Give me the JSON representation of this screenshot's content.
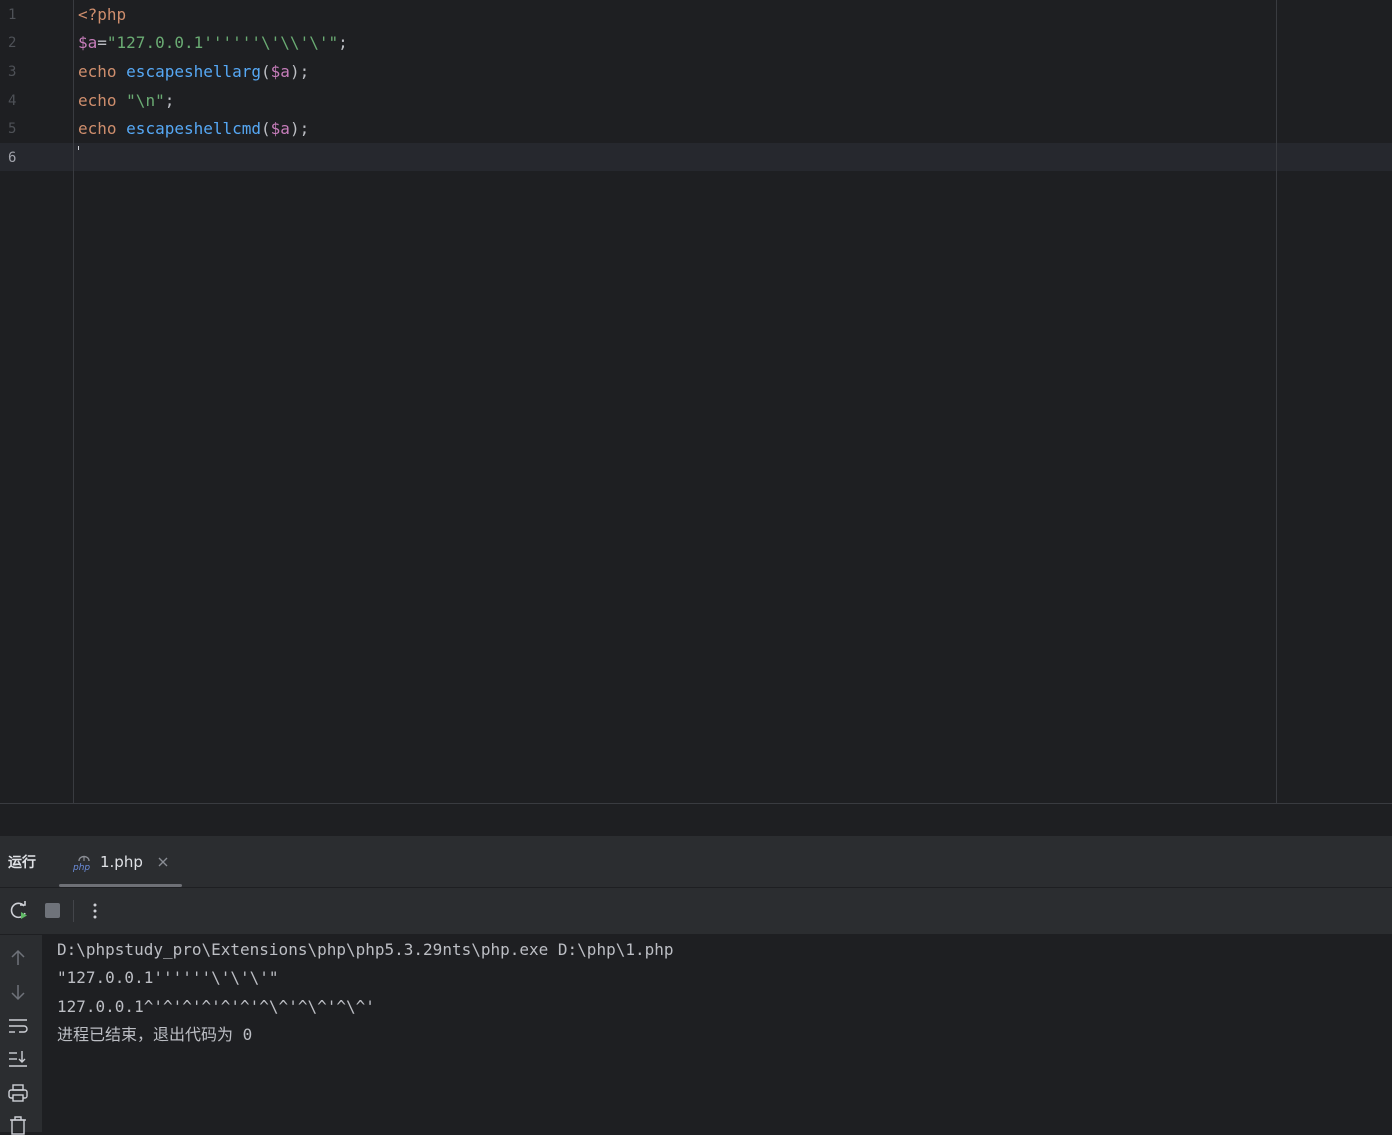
{
  "editor": {
    "line_numbers": [
      "1",
      "2",
      "3",
      "4",
      "5",
      "6"
    ],
    "lines": [
      [
        {
          "t": "<?php",
          "c": "#cf8e6d"
        }
      ],
      [
        {
          "t": "$a",
          "c": "#c77dbb"
        },
        {
          "t": "=",
          "c": "#bcbec4"
        },
        {
          "t": "\"127.0.0.1''''''\\'\\\\'\\'\"",
          "c": "#6aab73"
        },
        {
          "t": ";",
          "c": "#bcbec4"
        }
      ],
      [
        {
          "t": "echo ",
          "c": "#cf8e6d"
        },
        {
          "t": "escapeshellarg",
          "c": "#56a8f5"
        },
        {
          "t": "(",
          "c": "#bcbec4"
        },
        {
          "t": "$a",
          "c": "#c77dbb"
        },
        {
          "t": ");",
          "c": "#bcbec4"
        }
      ],
      [
        {
          "t": "echo ",
          "c": "#cf8e6d"
        },
        {
          "t": "\"\\n\"",
          "c": "#6aab73"
        },
        {
          "t": ";",
          "c": "#bcbec4"
        }
      ],
      [
        {
          "t": "echo ",
          "c": "#cf8e6d"
        },
        {
          "t": "escapeshellcmd",
          "c": "#56a8f5"
        },
        {
          "t": "(",
          "c": "#bcbec4"
        },
        {
          "t": "$a",
          "c": "#c77dbb"
        },
        {
          "t": ");",
          "c": "#bcbec4"
        }
      ],
      []
    ],
    "current_line": 6
  },
  "run_panel": {
    "title": "运行",
    "tab": {
      "label": "1.php",
      "icon": "php-file-icon"
    },
    "toolbar_icons": [
      "rerun-icon",
      "stop-icon",
      "more-vertical-icon"
    ],
    "side_icons": [
      "arrow-up-icon",
      "arrow-down-icon",
      "soft-wrap-icon",
      "scroll-to-end-icon",
      "print-icon",
      "trash-icon"
    ],
    "console_lines": [
      "D:\\phpstudy_pro\\Extensions\\php\\php5.3.29nts\\php.exe D:\\php\\1.php",
      "\"127.0.0.1''''''\\'\\'\\'\"",
      "127.0.0.1^'^'^'^'^'^'^\\^'^\\^'^\\^'",
      "进程已结束，退出代码为 0"
    ]
  },
  "colors": {
    "editor_bg": "#1e1f22",
    "panel_bg": "#2b2d30",
    "keyword": "#cf8e6d",
    "function": "#56a8f5",
    "string": "#6aab73",
    "variable": "#c77dbb",
    "text": "#bcbec4"
  }
}
